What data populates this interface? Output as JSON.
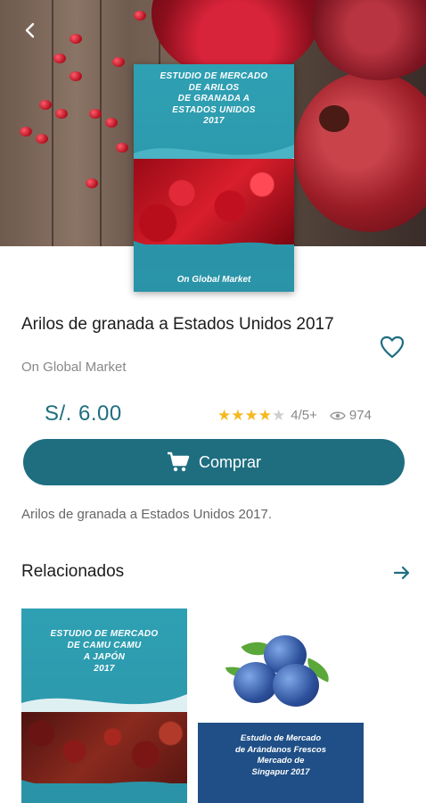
{
  "product": {
    "cover": {
      "title_lines": [
        "ESTUDIO DE MERCADO",
        "DE ARILOS",
        "DE GRANADA A",
        "ESTADOS UNIDOS",
        "2017"
      ],
      "brand": "On Global Market"
    },
    "title": "Arilos de granada a Estados Unidos 2017",
    "publisher": "On Global Market",
    "price": "S/. 6.00",
    "rating": {
      "value": 4,
      "max": 5,
      "label": "4/5",
      "suffix": "+",
      "color": "#f5b820",
      "empty_color": "#cfcfcf"
    },
    "views": "974",
    "buy_label": "Comprar",
    "description": "Arilos de granada a Estados Unidos 2017.",
    "accent_color": "#1e6e80"
  },
  "related": {
    "title": "Relacionados",
    "items": [
      {
        "cover_lines": [
          "ESTUDIO DE MERCADO",
          "DE CAMU CAMU",
          "A JAPÓN",
          "2017"
        ]
      },
      {
        "cover_lines": [
          "Estudio de Mercado",
          "de Arándanos Frescos",
          "Mercado de",
          "Singapur 2017"
        ]
      }
    ]
  },
  "icons": {
    "back": "arrow-left-icon",
    "favorite": "heart-outline-icon",
    "cart": "cart-icon",
    "views": "eye-icon",
    "more": "arrow-right-icon"
  }
}
